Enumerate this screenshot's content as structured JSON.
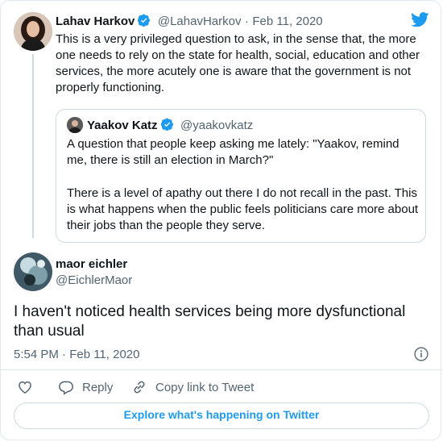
{
  "original_tweet": {
    "author_name": "Lahav Harkov",
    "handle": "@LahavHarkov",
    "separator": "·",
    "date": "Feb 11, 2020",
    "text": "This is a very privileged question to ask, in the sense that, the more one needs to rely on the state for health, social, education and other services, the more acutely one is aware that the government is not properly functioning.",
    "quoted": {
      "author_name": "Yaakov Katz",
      "handle": "@yaakovkatz",
      "text_1": "A question that people keep asking me lately: \"Yaakov, remind me, there is still an election in March?\"",
      "text_2": "There is a level of apathy out there I do not recall in the past. This is what happens when the public feels politicians care more about their jobs than the people they serve."
    }
  },
  "reply": {
    "author_name": "maor eichler",
    "handle": "@EichlerMaor",
    "text": "I haven't noticed health services being more dysfunctional than usual",
    "timestamp": "5:54 PM · Feb 11, 2020"
  },
  "actions": {
    "reply_label": "Reply",
    "copy_label": "Copy link to Tweet"
  },
  "explore_label": "Explore what's happening on Twitter",
  "colors": {
    "brand": "#1d9bf0",
    "muted": "#536471"
  },
  "icons": [
    "twitter-bird-icon",
    "verified-badge-icon",
    "info-icon",
    "heart-icon",
    "reply-icon",
    "link-icon"
  ]
}
